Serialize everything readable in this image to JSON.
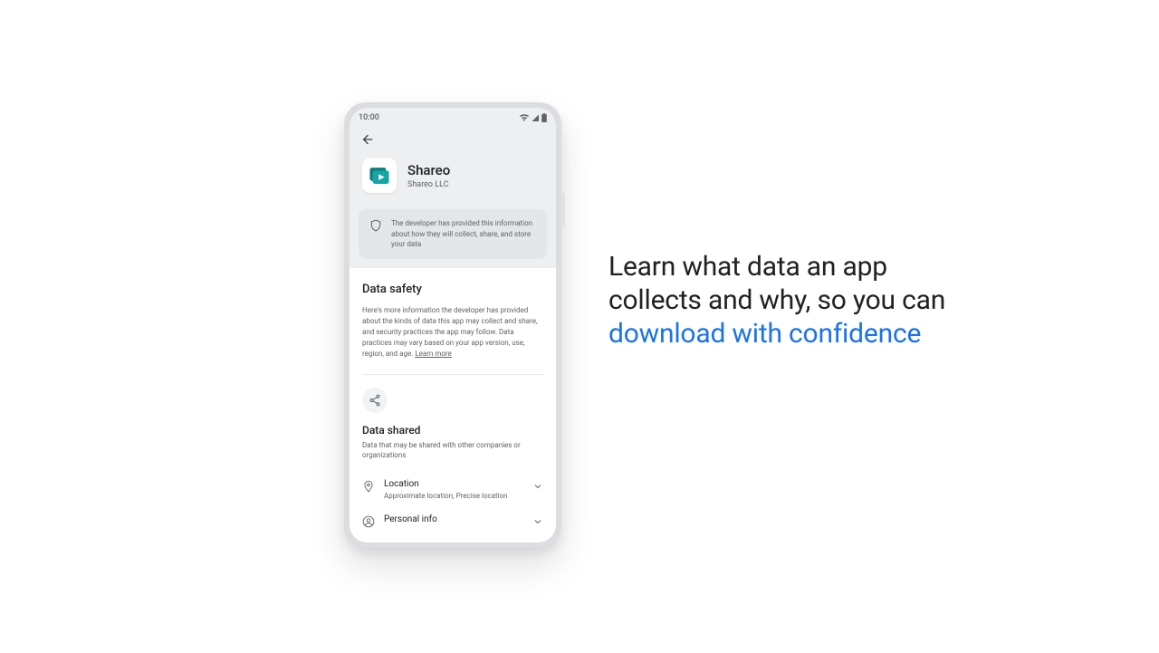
{
  "status": {
    "time": "10:00"
  },
  "app": {
    "name": "Shareo",
    "developer": "Shareo LLC",
    "icon_name": "shareo-app-icon",
    "icon_accent": "#107b7d"
  },
  "disclosure": {
    "text": "The developer has provided this information about how they will collect, share, and store your data"
  },
  "data_safety": {
    "title": "Data safety",
    "body": "Here's more information the developer has provided about the kinds of data this app may collect and share, and security practices the app may follow. Data practices may vary based on your app version, use, region, and age. ",
    "learn_more": "Learn more"
  },
  "shared": {
    "title": "Data shared",
    "subtitle": "Data that may be shared with other companies or organizations",
    "rows": [
      {
        "icon": "location-pin-icon",
        "title": "Location",
        "subtitle": "Approximate location, Precise location"
      },
      {
        "icon": "person-icon",
        "title": "Personal info",
        "subtitle": ""
      }
    ]
  },
  "marketing": {
    "line_normal_a": "Learn what data an app collects and why, so you can ",
    "line_highlight": "download with confidence"
  },
  "colors": {
    "accent_blue": "#1a73e8",
    "text_primary": "#202124",
    "text_secondary": "#5f6368"
  }
}
